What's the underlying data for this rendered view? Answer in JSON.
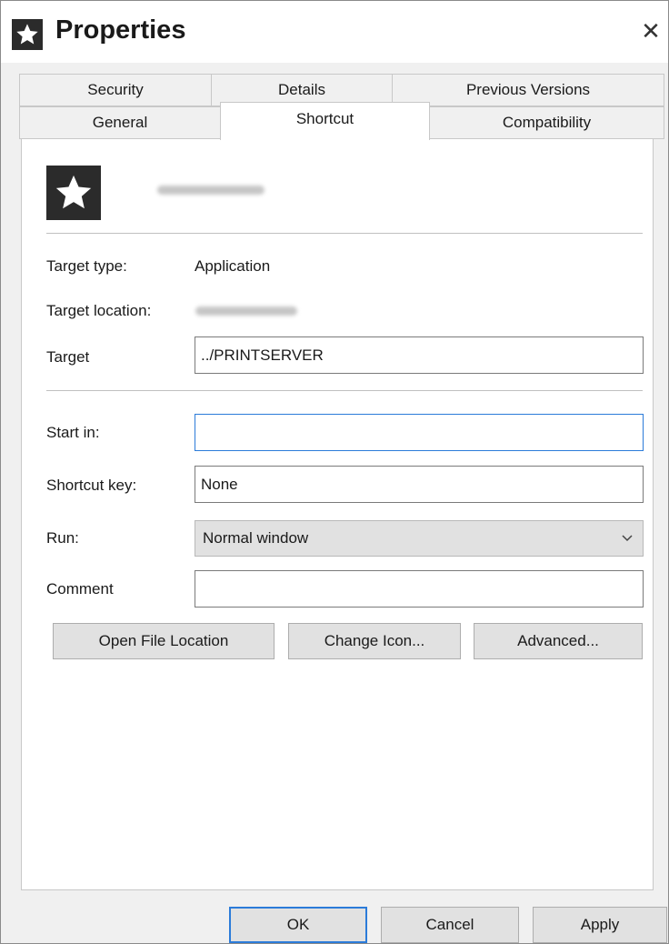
{
  "window": {
    "title": "Properties",
    "app_icon": "star-icon",
    "close_symbol": "✕"
  },
  "tabs_row1": [
    {
      "label": "Security"
    },
    {
      "label": "Details"
    },
    {
      "label": "Previous Versions"
    }
  ],
  "tabs_row2": [
    {
      "label": "General"
    },
    {
      "label": "Shortcut",
      "active": true
    },
    {
      "label": "Compatibility"
    }
  ],
  "shortcut": {
    "icon": "star-icon",
    "name_redacted": true,
    "target_type_label": "Target type:",
    "target_type_value": "Application",
    "target_location_label": "Target location:",
    "target_location_redacted": true,
    "target_label": "Target",
    "target_value": "../PRINTSERVER",
    "start_in_label": "Start in:",
    "start_in_value": "",
    "shortcut_key_label": "Shortcut key:",
    "shortcut_key_value": "None",
    "run_label": "Run:",
    "run_value": "Normal window",
    "comment_label": "Comment",
    "comment_value": ""
  },
  "action_buttons": {
    "open_file_location": "Open File Location",
    "change_icon": "Change Icon...",
    "advanced": "Advanced..."
  },
  "footer": {
    "ok": "OK",
    "cancel": "Cancel",
    "apply": "Apply"
  },
  "colors": {
    "accent": "#2b7bd9",
    "icon_bg": "#2b2b2b",
    "button_bg": "#e1e1e1"
  }
}
